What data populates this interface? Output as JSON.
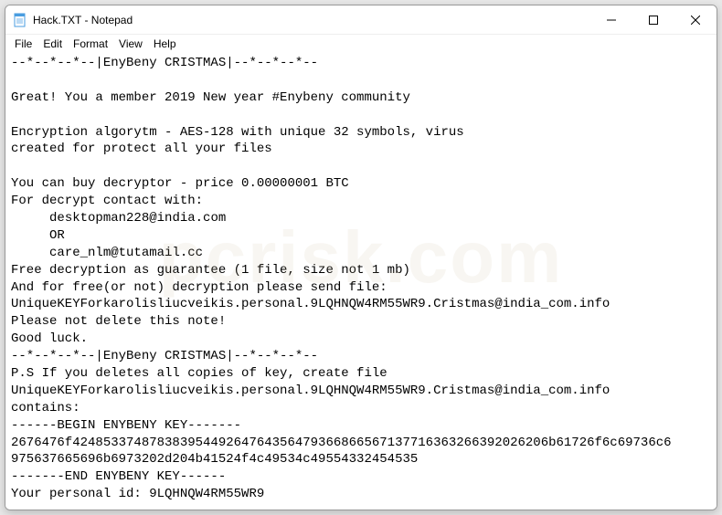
{
  "window": {
    "title": "Hack.TXT - Notepad"
  },
  "menu": {
    "file": "File",
    "edit": "Edit",
    "format": "Format",
    "view": "View",
    "help": "Help"
  },
  "content": {
    "line1": "--*--*--*--|EnyBeny CRISTMAS|--*--*--*--",
    "line2": "",
    "line3": "Great! You a member 2019 New year #Enybeny community",
    "line4": "",
    "line5": "Encryption algorytm - AES-128 with unique 32 symbols, virus",
    "line6": "created for protect all your files",
    "line7": "",
    "line8": "You can buy decryptor - price 0.00000001 BTC",
    "line9": "For decrypt contact with:",
    "line10": "     desktopman228@india.com",
    "line11": "     OR",
    "line12": "     care_nlm@tutamail.cc",
    "line13": "Free decryption as guarantee (1 file, size not 1 mb)",
    "line14": "And for free(or not) decryption please send file:",
    "line15": "UniqueKEYForkarolisliucveikis.personal.9LQHNQW4RM55WR9.Cristmas@india_com.info",
    "line16": "Please not delete this note!",
    "line17": "Good luck.",
    "line18": "--*--*--*--|EnyBeny CRISTMAS|--*--*--*--",
    "line19": "P.S If you deletes all copies of key, create file",
    "line20": "UniqueKEYForkarolisliucveikis.personal.9LQHNQW4RM55WR9.Cristmas@india_com.info",
    "line21": "contains:",
    "line22": "------BEGIN ENYBENY KEY-------",
    "line23": "2676476f42485337487838395449264764356479366866567137716363266392026206b61726f6c69736c6",
    "line24": "975637665696b6973202d204b41524f4c49534c49554332454535",
    "line25": "-------END ENYBENY KEY------",
    "line26": "Your personal id: 9LQHNQW4RM55WR9"
  },
  "watermark": "pcrisk.com"
}
